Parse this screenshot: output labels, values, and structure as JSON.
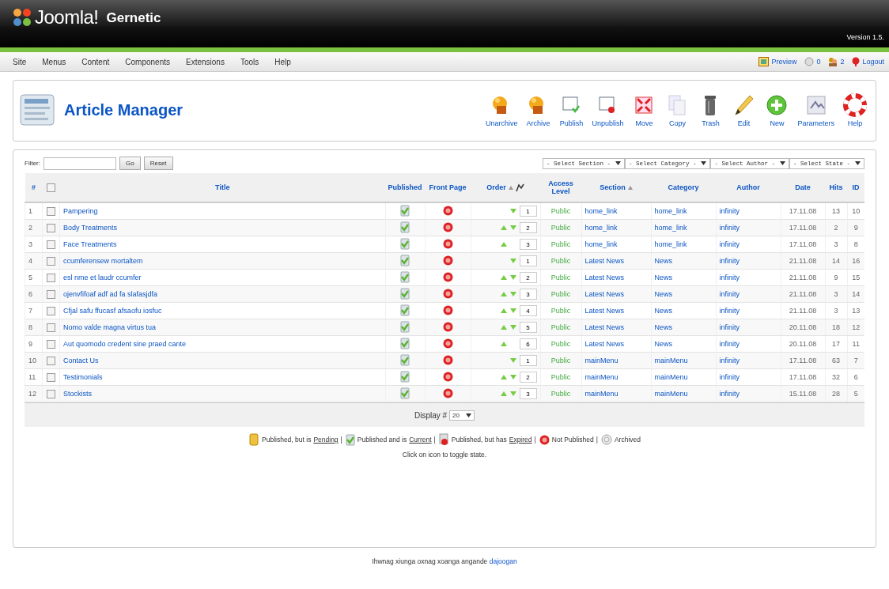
{
  "header": {
    "logo": "Joomla!",
    "site_name": "Gernetic",
    "version": "Version 1.5."
  },
  "menu": [
    "Site",
    "Menus",
    "Content",
    "Components",
    "Extensions",
    "Tools",
    "Help"
  ],
  "status": [
    {
      "kind": "preview",
      "label": "Preview"
    },
    {
      "kind": "messages",
      "label": "0"
    },
    {
      "kind": "users",
      "label": "2"
    },
    {
      "kind": "logout",
      "label": "Logout"
    }
  ],
  "page_title": "Article Manager",
  "toolbar": [
    {
      "kind": "unarchive",
      "label": "Unarchive"
    },
    {
      "kind": "archive",
      "label": "Archive"
    },
    {
      "kind": "publish",
      "label": "Publish"
    },
    {
      "kind": "unpublish",
      "label": "Unpublish"
    },
    {
      "kind": "move",
      "label": "Move"
    },
    {
      "kind": "copy",
      "label": "Copy"
    },
    {
      "kind": "trash",
      "label": "Trash"
    },
    {
      "kind": "edit",
      "label": "Edit"
    },
    {
      "kind": "new",
      "label": "New"
    },
    {
      "kind": "parameters",
      "label": "Parameters"
    },
    {
      "kind": "help",
      "label": "Help"
    }
  ],
  "filter": {
    "label": "Filter:",
    "go": "Go",
    "reset": "Reset"
  },
  "selects": [
    "- Select Section -",
    "- Select Category -",
    "- Select Author -",
    "- Select State -"
  ],
  "table": {
    "all_checked": false,
    "columns": [
      "#",
      "Title",
      "Published",
      "Front Page",
      "Order",
      "Access Level",
      "Section",
      "Category",
      "Author",
      "Date",
      "Hits",
      "ID"
    ],
    "rows": [
      {
        "num": "1",
        "checked": false,
        "title": "Pampering",
        "published": true,
        "front_page": false,
        "up": false,
        "down": true,
        "order": "1",
        "access": "Public",
        "section": "home_link",
        "category": "home_link",
        "author": "infinity",
        "date": "17.11.08",
        "hits": "13",
        "id": "10"
      },
      {
        "num": "2",
        "checked": false,
        "title": "Body Treatments",
        "published": true,
        "front_page": false,
        "up": true,
        "down": true,
        "order": "2",
        "access": "Public",
        "section": "home_link",
        "category": "home_link",
        "author": "infinity",
        "date": "17.11.08",
        "hits": "2",
        "id": "9"
      },
      {
        "num": "3",
        "checked": false,
        "title": "Face Treatments",
        "published": true,
        "front_page": false,
        "up": true,
        "down": false,
        "order": "3",
        "access": "Public",
        "section": "home_link",
        "category": "home_link",
        "author": "infinity",
        "date": "17.11.08",
        "hits": "3",
        "id": "8"
      },
      {
        "num": "4",
        "checked": false,
        "title": "ccumferensew mortaltem",
        "published": true,
        "front_page": false,
        "up": false,
        "down": true,
        "order": "1",
        "access": "Public",
        "section": "Latest News",
        "category": "News",
        "author": "infinity",
        "date": "21.11.08",
        "hits": "14",
        "id": "16"
      },
      {
        "num": "5",
        "checked": false,
        "title": "esl nme et laudr ccumfer",
        "published": true,
        "front_page": false,
        "up": true,
        "down": true,
        "order": "2",
        "access": "Public",
        "section": "Latest News",
        "category": "News",
        "author": "infinity",
        "date": "21.11.08",
        "hits": "9",
        "id": "15"
      },
      {
        "num": "6",
        "checked": false,
        "title": "ojenvfifoaf adf ad fa slafasjdfa",
        "published": true,
        "front_page": false,
        "up": true,
        "down": true,
        "order": "3",
        "access": "Public",
        "section": "Latest News",
        "category": "News",
        "author": "infinity",
        "date": "21.11.08",
        "hits": "3",
        "id": "14"
      },
      {
        "num": "7",
        "checked": false,
        "title": "Cfjal safu ffucasf afsaofu iosfuc",
        "published": true,
        "front_page": false,
        "up": true,
        "down": true,
        "order": "4",
        "access": "Public",
        "section": "Latest News",
        "category": "News",
        "author": "infinity",
        "date": "21.11.08",
        "hits": "3",
        "id": "13"
      },
      {
        "num": "8",
        "checked": false,
        "title": "Nomo valde magna virtus tua",
        "published": true,
        "front_page": false,
        "up": true,
        "down": true,
        "order": "5",
        "access": "Public",
        "section": "Latest News",
        "category": "News",
        "author": "infinity",
        "date": "20.11.08",
        "hits": "18",
        "id": "12"
      },
      {
        "num": "9",
        "checked": false,
        "title": "Aut quomodo credent sine praed cante",
        "published": true,
        "front_page": false,
        "up": true,
        "down": false,
        "order": "6",
        "access": "Public",
        "section": "Latest News",
        "category": "News",
        "author": "infinity",
        "date": "20.11.08",
        "hits": "17",
        "id": "11"
      },
      {
        "num": "10",
        "checked": false,
        "title": "Contact Us",
        "published": true,
        "front_page": false,
        "up": false,
        "down": true,
        "order": "1",
        "access": "Public",
        "section": "mainMenu",
        "category": "mainMenu",
        "author": "infinity",
        "date": "17.11.08",
        "hits": "63",
        "id": "7"
      },
      {
        "num": "11",
        "checked": false,
        "title": "Testimonials",
        "published": true,
        "front_page": false,
        "up": true,
        "down": true,
        "order": "2",
        "access": "Public",
        "section": "mainMenu",
        "category": "mainMenu",
        "author": "infinity",
        "date": "17.11.08",
        "hits": "32",
        "id": "6"
      },
      {
        "num": "12",
        "checked": false,
        "title": "Stockists",
        "published": true,
        "front_page": false,
        "up": true,
        "down": true,
        "order": "3",
        "access": "Public",
        "section": "mainMenu",
        "category": "mainMenu",
        "author": "infinity",
        "date": "15.11.08",
        "hits": "28",
        "id": "5"
      }
    ]
  },
  "display": {
    "label": "Display #",
    "value": "20"
  },
  "legend": [
    {
      "kind": "pending",
      "text": "Published, but is",
      "link": "Pending",
      "separator": "|"
    },
    {
      "kind": "current",
      "text": "Published and is",
      "link": "Current",
      "separator": "|"
    },
    {
      "kind": "expired",
      "text": "Published, but has",
      "link": "Expired",
      "separator": "|"
    },
    {
      "kind": "unpublished",
      "text": "Not Published",
      "separator": "|"
    },
    {
      "kind": "archived",
      "text": "Archived"
    }
  ],
  "hint": "Click on icon to toggle state.",
  "footer": {
    "text": "Ihwnag xiunga oxnag xoanga angande",
    "link": "dajoogan"
  }
}
